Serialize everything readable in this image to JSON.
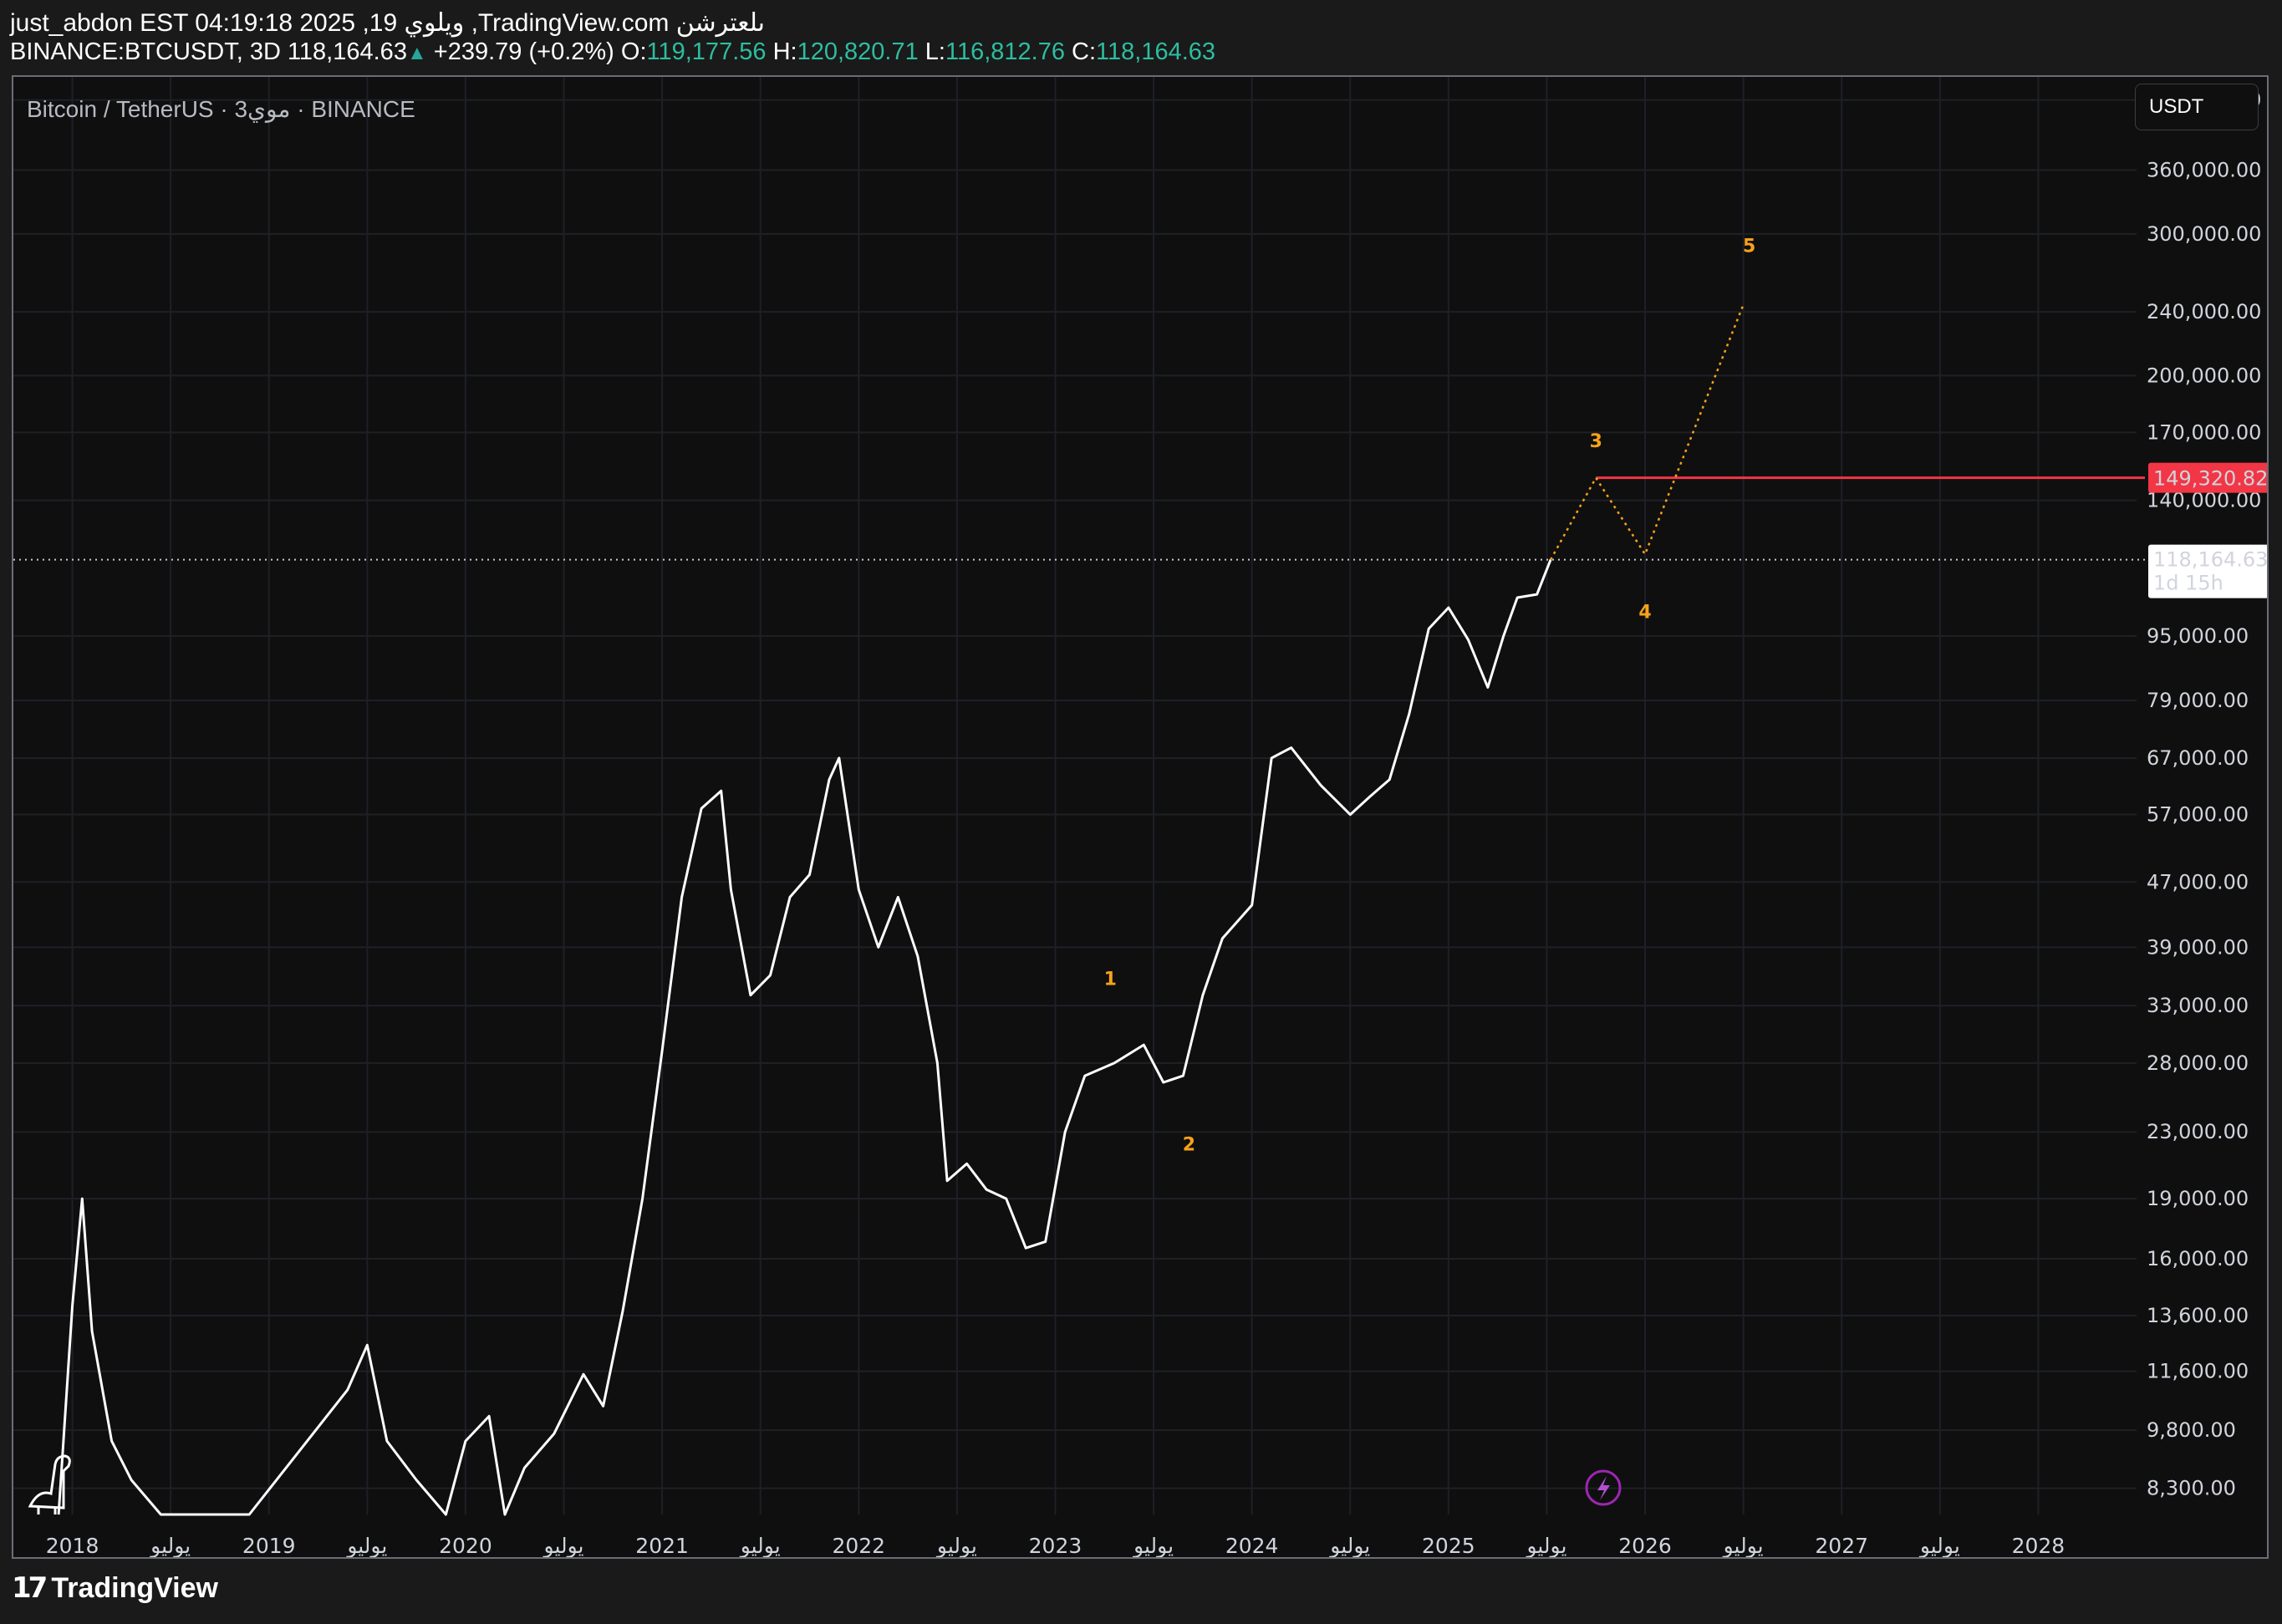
{
  "header": {
    "line1": "just_abdon EST 04:19:18 2025 ,19 ويلوي ,TradingView.com ىلعترشن",
    "symbol": "BINANCE:BTCUSDT, 3D",
    "last": "118,164.63",
    "change": "+239.79 (+0.2%)",
    "o_label": "O:",
    "o": "119,177.56",
    "h_label": "H:",
    "h": "120,820.71",
    "l_label": "L:",
    "l": "116,812.76",
    "c_label": "C:",
    "c": "118,164.63"
  },
  "chart": {
    "legend": "Bitcoin / TetherUS · 3موي · BINANCE",
    "currency_button": "USDT",
    "price_marker": "149,320.82",
    "last_price_marker": "118,164.63",
    "countdown": "1d 15h",
    "colors": {
      "background": "#0f0f0f",
      "price": "#ffffff",
      "wave": "#f7a21b",
      "level": "#f23645",
      "grid": "#1e2026"
    }
  },
  "chart_data": {
    "type": "line",
    "title": "Bitcoin / TetherUS · 3موي · BINANCE",
    "yscale": "log",
    "ylim": [
      7700,
      470000
    ],
    "xlim": [
      2017.7,
      2028.5
    ],
    "y_ticks": [
      "440,000.00",
      "360,000.00",
      "300,000.00",
      "240,000.00",
      "200,000.00",
      "170,000.00",
      "140,000.00",
      "95,000.00",
      "79,000.00",
      "67,000.00",
      "57,000.00",
      "47,000.00",
      "39,000.00",
      "33,000.00",
      "28,000.00",
      "23,000.00",
      "19,000.00",
      "16,000.00",
      "13,600.00",
      "11,600.00",
      "9,800.00",
      "8,300.00"
    ],
    "x_ticks": [
      "2018",
      "يوليو",
      "2019",
      "يوليو",
      "2020",
      "يوليو",
      "2021",
      "يوليو",
      "2022",
      "يوليو",
      "2023",
      "يوليو",
      "2024",
      "يوليو",
      "2025",
      "يوليو",
      "2026",
      "يوليو",
      "2027",
      "يوليو",
      "2028"
    ],
    "series": [
      {
        "x": [
          2017.93,
          2018.0,
          2018.05,
          2018.1,
          2018.2,
          2018.3,
          2018.45,
          2018.55,
          2018.9,
          2019.4,
          2019.5,
          2019.6,
          2019.75,
          2019.9,
          2020.0,
          2020.12,
          2020.2,
          2020.3,
          2020.45,
          2020.6,
          2020.7,
          2020.8,
          2020.9,
          2021.0,
          2021.1,
          2021.2,
          2021.3,
          2021.35,
          2021.45,
          2021.55,
          2021.65,
          2021.75,
          2021.85,
          2021.9,
          2022.0,
          2022.1,
          2022.2,
          2022.3,
          2022.4,
          2022.45,
          2022.55,
          2022.65,
          2022.75,
          2022.85,
          2022.95,
          2023.05,
          2023.15,
          2023.3,
          2023.45,
          2023.55,
          2023.65,
          2023.75,
          2023.85,
          2024.0,
          2024.1,
          2024.2,
          2024.35,
          2024.5,
          2024.6,
          2024.7,
          2024.8,
          2024.9,
          2025.0,
          2025.1,
          2025.2,
          2025.28,
          2025.35,
          2025.45,
          2025.52
        ],
        "y": [
          7700,
          14000,
          19000,
          13000,
          9500,
          8500,
          7700,
          7700,
          7700,
          11000,
          12500,
          9500,
          8500,
          7700,
          9500,
          10200,
          7700,
          8800,
          9700,
          11500,
          10500,
          13800,
          19000,
          29000,
          45000,
          58000,
          61000,
          46000,
          34000,
          36000,
          45000,
          48000,
          63000,
          67000,
          46000,
          39000,
          45000,
          38000,
          28000,
          20000,
          21000,
          19500,
          19000,
          16500,
          16800,
          23000,
          27000,
          28000,
          29500,
          26500,
          27000,
          34000,
          40000,
          44000,
          67000,
          69000,
          62000,
          57000,
          60000,
          63000,
          76000,
          97000,
          103000,
          94000,
          82000,
          95000,
          106000,
          107000,
          118164
        ]
      }
    ],
    "projection": {
      "x": [
        2025.52,
        2025.75,
        2026.0,
        2026.5
      ],
      "y": [
        118164,
        149320.82,
        120000,
        245000
      ]
    },
    "wave_labels": [
      {
        "text": "1",
        "x": 2023.28,
        "y": 35000
      },
      {
        "text": "2",
        "x": 2023.68,
        "y": 21800
      },
      {
        "text": "3",
        "x": 2025.75,
        "y": 163000
      },
      {
        "text": "4",
        "x": 2026.0,
        "y": 100000
      },
      {
        "text": "5",
        "x": 2026.53,
        "y": 285000
      }
    ],
    "level_line": 149320.82,
    "last_price": 118164.63
  }
}
